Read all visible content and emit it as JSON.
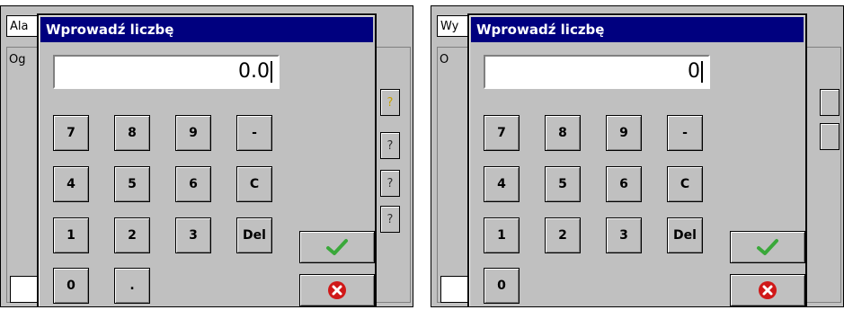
{
  "left": {
    "bg_tab": "Ala",
    "bg_sub": "Og",
    "dialog_title": "Wprowadź liczbę",
    "value": "0.0"
  },
  "right": {
    "bg_tab": "Wy",
    "bg_sub": "O",
    "dialog_title": "Wprowadź liczbę",
    "value": "0"
  },
  "keypad": {
    "k7": "7",
    "k8": "8",
    "k9": "9",
    "minus": "-",
    "k4": "4",
    "k5": "5",
    "k6": "6",
    "clear": "C",
    "k1": "1",
    "k2": "2",
    "k3": "3",
    "del": "Del",
    "k0": "0",
    "dot": "."
  },
  "icons": {
    "ok": "checkmark-icon",
    "cancel": "cancel-icon",
    "side": "question-icon"
  },
  "colors": {
    "titlebar": "#00007f",
    "ok_green": "#3aa83a",
    "cancel_red": "#d01818"
  }
}
